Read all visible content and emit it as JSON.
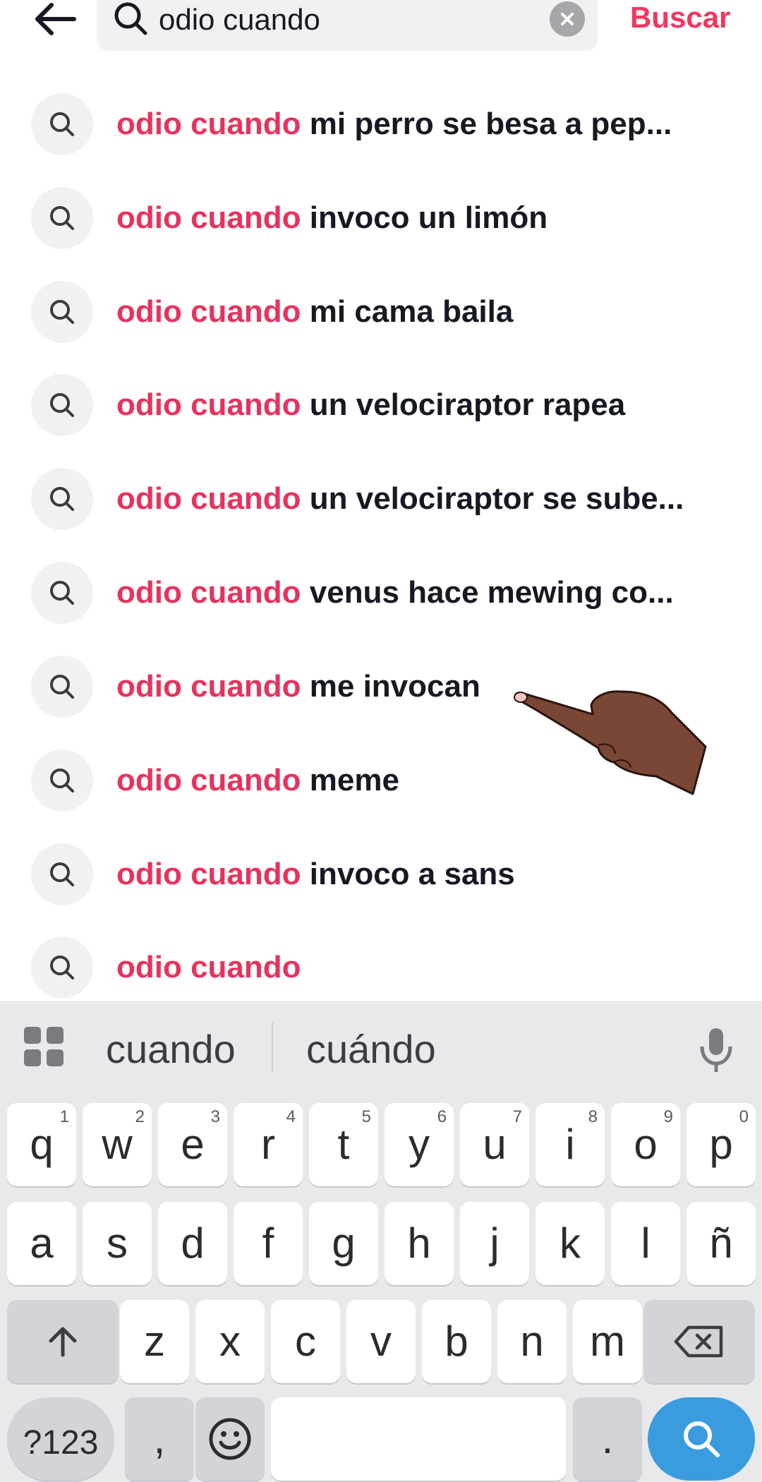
{
  "search": {
    "query": "odio cuando",
    "submit_label": "Buscar"
  },
  "suggestions": [
    {
      "highlight": "odio cuando",
      "rest": " mi perro se besa a pep..."
    },
    {
      "highlight": "odio cuando",
      "rest": " invoco un limón"
    },
    {
      "highlight": "odio cuando",
      "rest": " mi cama baila"
    },
    {
      "highlight": "odio cuando",
      "rest": " un velociraptor rapea"
    },
    {
      "highlight": "odio cuando",
      "rest": " un velociraptor se sube..."
    },
    {
      "highlight": "odio cuando",
      "rest": " venus hace mewing co..."
    },
    {
      "highlight": "odio cuando",
      "rest": " me invocan"
    },
    {
      "highlight": "odio cuando",
      "rest": " meme"
    },
    {
      "highlight": "odio cuando",
      "rest": " invoco a sans"
    },
    {
      "highlight": "odio cuando",
      "rest": ""
    }
  ],
  "keyboard": {
    "word_suggestions": [
      "cuando",
      "cuándo"
    ],
    "row1": [
      {
        "ch": "q",
        "sup": "1"
      },
      {
        "ch": "w",
        "sup": "2"
      },
      {
        "ch": "e",
        "sup": "3"
      },
      {
        "ch": "r",
        "sup": "4"
      },
      {
        "ch": "t",
        "sup": "5"
      },
      {
        "ch": "y",
        "sup": "6"
      },
      {
        "ch": "u",
        "sup": "7"
      },
      {
        "ch": "i",
        "sup": "8"
      },
      {
        "ch": "o",
        "sup": "9"
      },
      {
        "ch": "p",
        "sup": "0"
      }
    ],
    "row2": [
      "a",
      "s",
      "d",
      "f",
      "g",
      "h",
      "j",
      "k",
      "l",
      "ñ"
    ],
    "row3": [
      "z",
      "x",
      "c",
      "v",
      "b",
      "n",
      "m"
    ],
    "sym_label": "?123",
    "comma_label": ",",
    "period_label": ".",
    "colors": {
      "accent": "#e8325e",
      "search_key": "#3a9cde"
    }
  }
}
